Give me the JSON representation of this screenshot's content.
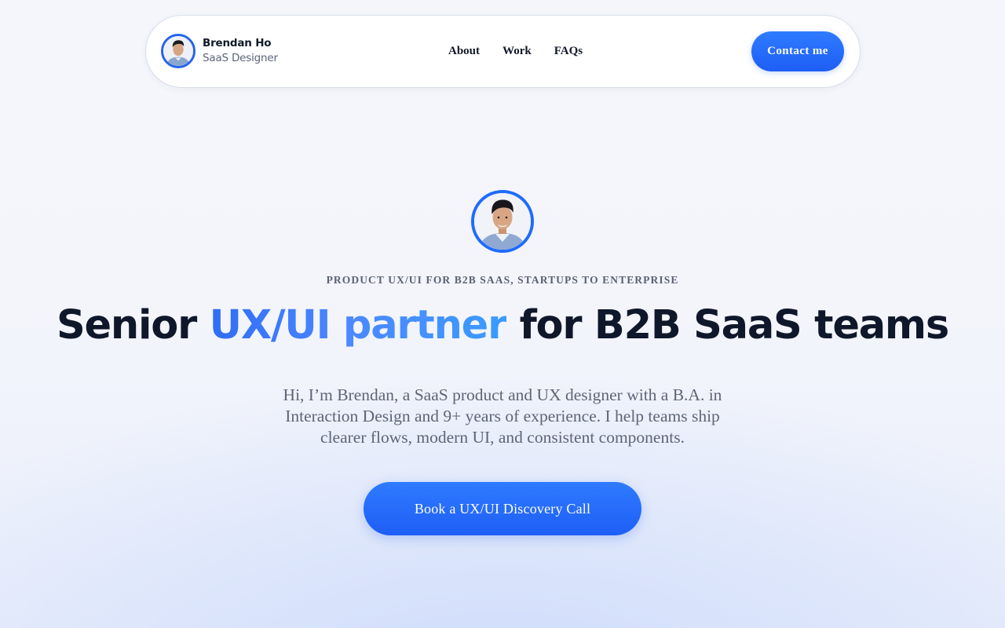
{
  "nav": {
    "name": "Brendan Ho",
    "role": "SaaS Designer",
    "links": [
      "About",
      "Work",
      "FAQs"
    ],
    "contact_label": "Contact me"
  },
  "hero": {
    "eyebrow": "PRODUCT UX/UI FOR B2B SAAS, STARTUPS TO ENTERPRISE",
    "headline_prefix": "Senior ",
    "headline_accent": "UX/UI partner",
    "headline_suffix": " for B2B SaaS teams",
    "intro": "Hi, I’m Brendan, a SaaS product and UX designer with a B.A. in Interaction Design and 9+ years of experience. I help teams ship clearer flows, modern UI, and consistent components.",
    "cta_label": "Book a UX/UI Discovery Call"
  },
  "colors": {
    "accent": "#1f6bff",
    "text": "#0f172a",
    "muted": "#5f6577"
  }
}
